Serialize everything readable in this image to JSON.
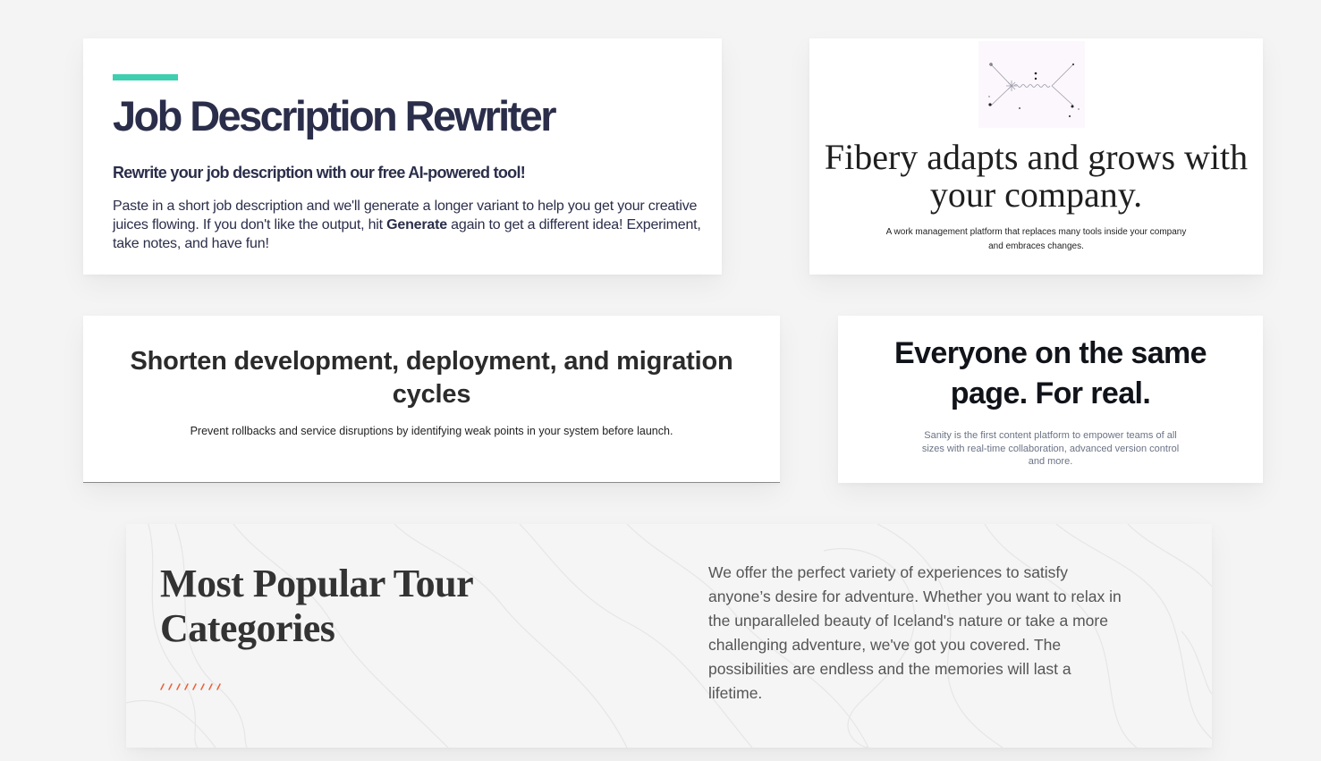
{
  "job_card": {
    "title": "Job Description Rewriter",
    "subtitle": "Rewrite your job description with our free AI-powered tool!",
    "desc_before": "Paste in a short job description and we'll generate a longer variant to help you get your creative juices flowing. If you don't like the output, hit ",
    "desc_bold": "Generate",
    "desc_after": " again to get a different idea! Experiment, take notes, and have fun!",
    "accent_color": "#3ecfb0"
  },
  "fibery_card": {
    "illustration_icon": "particle-diagram-icon",
    "title": "Fibery adapts and grows with your company.",
    "description": "A work management platform that replaces many tools inside your company and embraces changes."
  },
  "shorten_card": {
    "title": "Shorten development, deployment, and migration cycles",
    "description": "Prevent rollbacks and service disruptions by identifying weak points in your system before launch."
  },
  "sanity_card": {
    "title": "Everyone on the same page. For real.",
    "description": "Sanity is the first content platform to empower teams of all sizes with real-time collaboration, advanced version control and more."
  },
  "tours_card": {
    "title": "Most Popular Tour Categories",
    "description": "We offer the perfect variety of experiences to satisfy anyone’s desire for adventure. Whether you want to relax in the unparalleled beauty of Iceland's nature or take a more challenging adventure, we've got you covered. The possibilities are endless and the memories will last a lifetime.",
    "accent_color": "#e8623a",
    "decoration_icon": "dashed-divider-icon"
  }
}
